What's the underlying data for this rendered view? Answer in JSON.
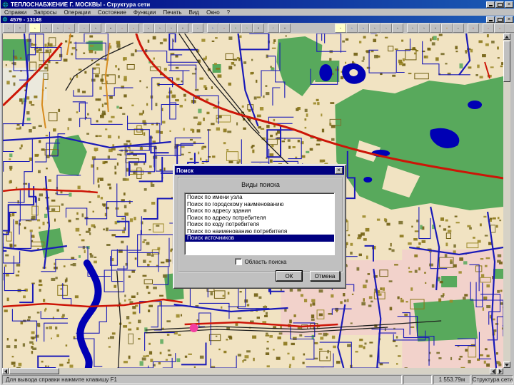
{
  "window": {
    "title": "ТЕПЛОСНАБЖЕНИЕ Г. МОСКВЫ - Структура сети"
  },
  "menu": {
    "items": [
      "Справки",
      "Запросы",
      "Операции",
      "Состояние",
      "Функции",
      "Печать",
      "Вид",
      "Окно",
      "?"
    ]
  },
  "child_window": {
    "title": "4579 - 13148"
  },
  "toolbar": {
    "buttons": [
      "link",
      "paste",
      "select",
      "select-node",
      "select-area",
      "select-object",
      "edit",
      "edit-area",
      "search",
      "xy-locate",
      "erase",
      "pan",
      "zoom-in",
      "zoom-out",
      "zoom-window",
      "undo",
      "network",
      "view-layers",
      "source-network",
      "consumer-network",
      "grid",
      "copy-pages",
      "print",
      "select-2",
      "select-blue",
      "select-area-blue",
      "select-3",
      "link-2",
      "edit-area-2",
      "zoom-in-2",
      "zoom-out-2",
      "zoom-window-2",
      "zoom-extent",
      "pan-2",
      "frame",
      "xy-locate-2",
      "erase-2",
      "new-page"
    ]
  },
  "dialog": {
    "title": "Поиск",
    "group_label": "Виды поиска",
    "items": [
      "Поиск по имени узла",
      "Поиск по городскому наименованию",
      "Поиск по адресу здания",
      "Поиск по адресу потребителя",
      "Поиск по коду потребителя",
      "Поиск по наименованию потребителя",
      "Поиск источников"
    ],
    "selected_index": 6,
    "checkbox_label": "Область поиска",
    "ok_label": "ОК",
    "cancel_label": "Отмена"
  },
  "status": {
    "help": "Для вывода справки нажмите клавишу F1",
    "scale": "1 553.79м",
    "mode": "Структура сети"
  },
  "icons": {
    "close": "×"
  },
  "map": {
    "colors": {
      "base": "#f1e3c2",
      "park": "#58a95c",
      "water": "#0000b4",
      "network": "#1a1ab8",
      "buildings": "#8a7618",
      "highway": "#cc1507",
      "railway": "#1c1c1c",
      "accent_orange": "#d78c20",
      "pink_area": "#f2d2cb",
      "light_area": "#ebe9dd",
      "poi": "#f23fa0"
    }
  }
}
